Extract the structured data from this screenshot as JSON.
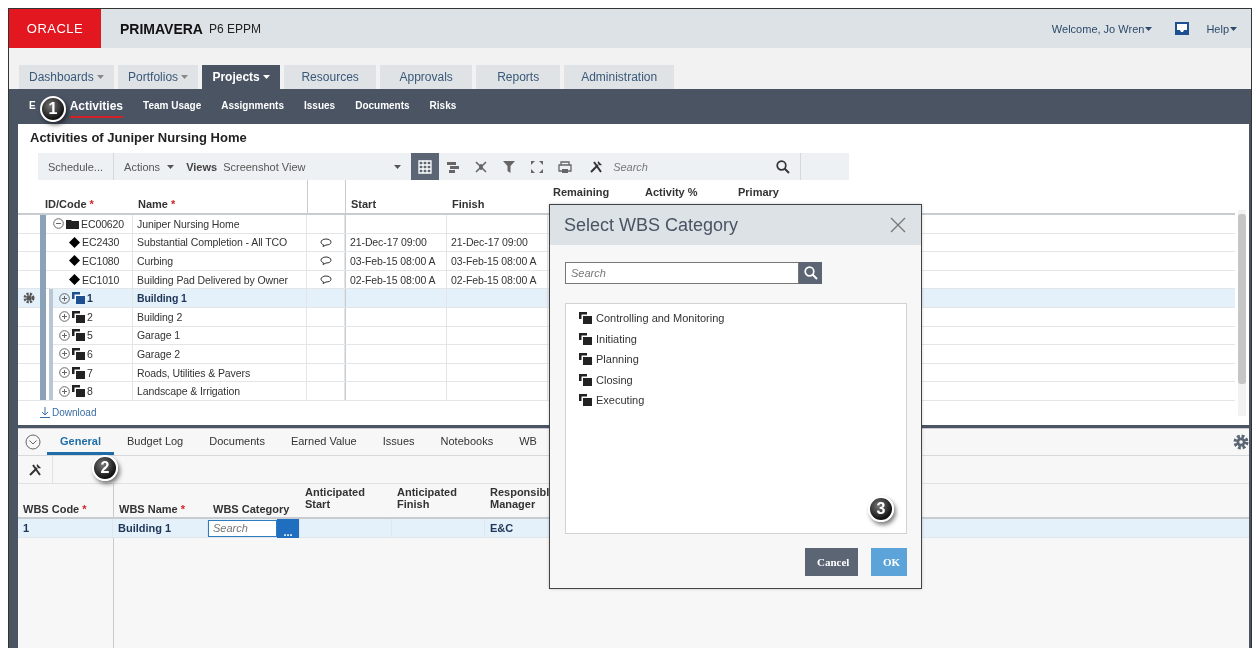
{
  "header": {
    "logo": "ORACLE",
    "product": "PRIMAVERA",
    "edition": "P6 EPPM",
    "user_menu": "Welcome, Jo Wren",
    "help_menu": "Help"
  },
  "main_tabs": [
    {
      "label": "Dashboards",
      "dropdown": true,
      "selected": false
    },
    {
      "label": "Portfolios",
      "dropdown": true,
      "selected": false
    },
    {
      "label": "Projects",
      "dropdown": true,
      "selected": true
    },
    {
      "label": "Resources",
      "dropdown": false,
      "selected": false
    },
    {
      "label": "Approvals",
      "dropdown": false,
      "selected": false
    },
    {
      "label": "Reports",
      "dropdown": false,
      "selected": false
    },
    {
      "label": "Administration",
      "dropdown": false,
      "selected": false
    }
  ],
  "sub_tabs": [
    {
      "label": "E",
      "selected": false
    },
    {
      "label": "Activities",
      "selected": true
    },
    {
      "label": "Team Usage",
      "selected": false
    },
    {
      "label": "Assignments",
      "selected": false
    },
    {
      "label": "Issues",
      "selected": false
    },
    {
      "label": "Documents",
      "selected": false
    },
    {
      "label": "Risks",
      "selected": false
    }
  ],
  "activities": {
    "title": "Activities of Juniper Nursing Home",
    "toolbar": {
      "schedule": "Schedule...",
      "actions": "Actions",
      "views_label": "Views",
      "view_name": "Screenshot View",
      "search_placeholder": "Search",
      "tools": [
        {
          "kind": "grid",
          "selected": true
        },
        {
          "kind": "gantt",
          "selected": false
        },
        {
          "kind": "network",
          "selected": false
        },
        {
          "kind": "filter",
          "selected": false
        },
        {
          "kind": "expand",
          "selected": false
        },
        {
          "kind": "print",
          "selected": false
        }
      ]
    },
    "columns": [
      {
        "label": "ID/Code",
        "required": "*"
      },
      {
        "label": "Name",
        "required": "*"
      },
      {
        "label": "Start"
      },
      {
        "label": "Finish"
      },
      {
        "label": "Remaining"
      },
      {
        "label": "Activity %"
      },
      {
        "label": "Primary"
      }
    ],
    "rows": [
      {
        "kind": "project",
        "expanded": true,
        "selected": false,
        "id": "EC00620",
        "name": "Juniper Nursing Home",
        "has_notes": false
      },
      {
        "kind": "milestone",
        "selected": false,
        "id": "EC2430",
        "name": "Substantial Completion - All TCO",
        "has_notes": true,
        "start": "21-Dec-17 09:00",
        "finish": "21-Dec-17 09:00"
      },
      {
        "kind": "milestone",
        "selected": false,
        "id": "EC1080",
        "name": "Curbing",
        "has_notes": true,
        "start": "03-Feb-15 08:00 A",
        "finish": "03-Feb-15 08:00 A"
      },
      {
        "kind": "milestone",
        "selected": false,
        "id": "EC1010",
        "name": "Building Pad Delivered by Owner",
        "has_notes": true,
        "start": "02-Feb-15 08:00 A",
        "finish": "02-Feb-15 08:00 A"
      },
      {
        "kind": "wbs",
        "expanded": false,
        "selected": true,
        "id": "1",
        "name": "Building 1",
        "has_notes": false
      },
      {
        "kind": "wbs",
        "expanded": false,
        "selected": false,
        "id": "2",
        "name": "Building 2",
        "has_notes": false
      },
      {
        "kind": "wbs",
        "expanded": false,
        "selected": false,
        "id": "5",
        "name": "Garage 1",
        "has_notes": false
      },
      {
        "kind": "wbs",
        "expanded": false,
        "selected": false,
        "id": "6",
        "name": "Garage 2",
        "has_notes": false
      },
      {
        "kind": "wbs",
        "expanded": false,
        "selected": false,
        "id": "7",
        "name": "Roads, Utilities & Pavers",
        "has_notes": false
      },
      {
        "kind": "wbs",
        "expanded": false,
        "selected": false,
        "id": "8",
        "name": "Landscape & Irrigation",
        "has_notes": false
      }
    ],
    "download": "Download"
  },
  "details": {
    "tabs": [
      {
        "label": "General",
        "selected": true
      },
      {
        "label": "Budget Log",
        "selected": false
      },
      {
        "label": "Documents",
        "selected": false
      },
      {
        "label": "Earned Value",
        "selected": false
      },
      {
        "label": "Issues",
        "selected": false
      },
      {
        "label": "Notebooks",
        "selected": false
      },
      {
        "label": "WB",
        "selected": false
      }
    ],
    "columns": [
      {
        "label": "WBS Code",
        "required": "*"
      },
      {
        "label": "WBS Name",
        "required": "*"
      },
      {
        "label": "WBS Category"
      },
      {
        "label": "Anticipated Start"
      },
      {
        "label": "Anticipated Finish"
      },
      {
        "label": "Responsibl Manager"
      }
    ],
    "row": {
      "code": "1",
      "name": "Building 1",
      "category_placeholder": "Search",
      "category_button": "...",
      "manager": "E&C",
      "selected": true
    }
  },
  "dialog": {
    "title": "Select WBS Category",
    "search_placeholder": "Search",
    "items": [
      "Controlling and Monitoring",
      "Initiating",
      "Planning",
      "Closing",
      "Executing"
    ],
    "buttons": [
      {
        "label": "Cancel",
        "kind": "secondary"
      },
      {
        "label": "OK",
        "kind": "primary"
      }
    ]
  },
  "callouts": [
    "1",
    "2",
    "3"
  ]
}
